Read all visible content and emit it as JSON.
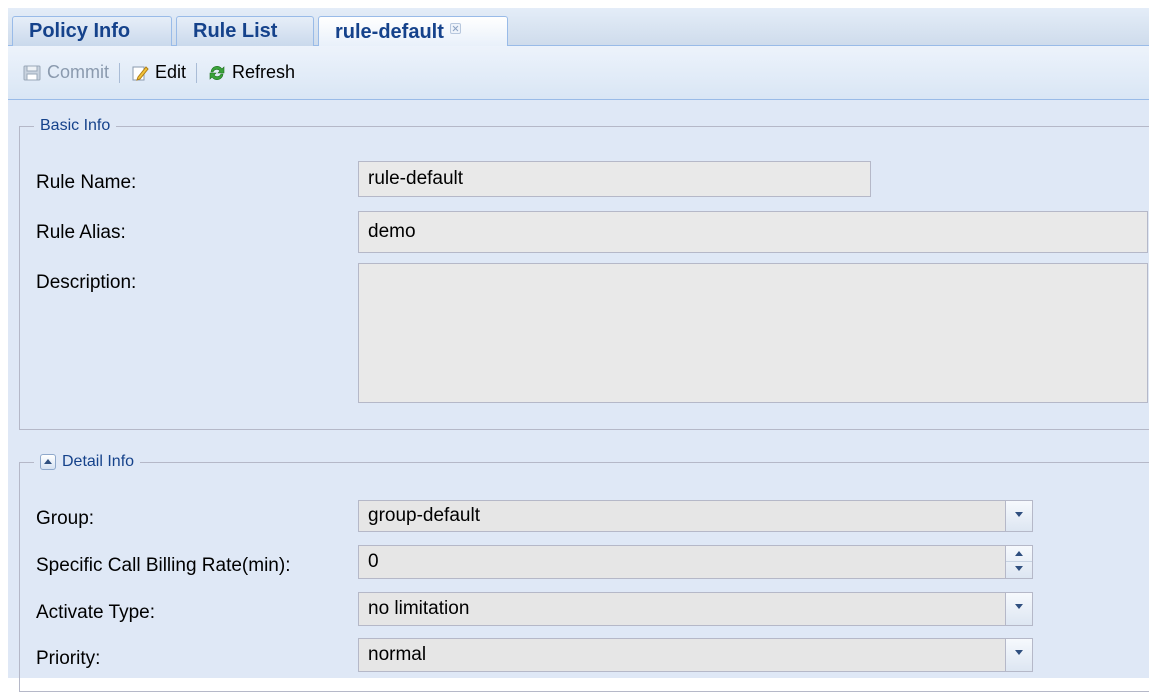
{
  "tabs": [
    {
      "label": "Policy Info",
      "active": false
    },
    {
      "label": "Rule List",
      "active": false
    },
    {
      "label": "rule-default",
      "active": true,
      "closable": true
    }
  ],
  "toolbar": {
    "commit_label": "Commit",
    "commit_icon": "save-icon",
    "edit_label": "Edit",
    "edit_icon": "pencil-icon",
    "refresh_label": "Refresh",
    "refresh_icon": "refresh-icon"
  },
  "basic_info": {
    "title": "Basic Info",
    "rule_name_label": "Rule Name:",
    "rule_name_value": "rule-default",
    "rule_alias_label": "Rule Alias:",
    "rule_alias_value": "demo",
    "description_label": "Description:",
    "description_value": ""
  },
  "detail_info": {
    "title": "Detail Info",
    "group_label": "Group:",
    "group_value": "group-default",
    "billing_label": "Specific Call Billing Rate(min):",
    "billing_value": "0",
    "activate_label": "Activate Type:",
    "activate_value": "no limitation",
    "priority_label": "Priority:",
    "priority_value": "normal"
  },
  "colors": {
    "tab_text": "#15428b",
    "panel_bg": "#dfe8f6",
    "border": "#99bbe8",
    "field_bg": "#e6e6e6"
  }
}
